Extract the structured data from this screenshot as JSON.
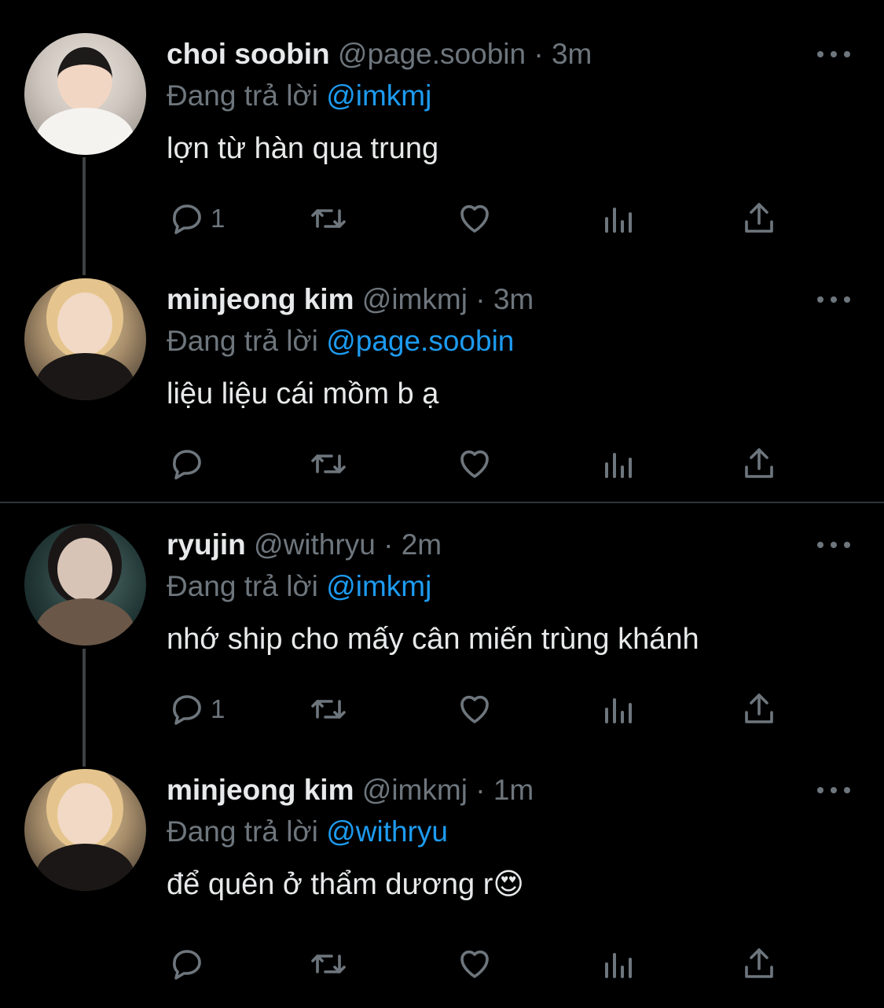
{
  "reply_prefix": "Đang trả lời",
  "dot": "·",
  "tweets": [
    {
      "name": "choi soobin",
      "handle": "@page.soobin",
      "time": "3m",
      "reply_to": "@imkmj",
      "text": "lợn từ hàn qua trung",
      "reply_count": "1"
    },
    {
      "name": "minjeong kim",
      "handle": "@imkmj",
      "time": "3m",
      "reply_to": "@page.soobin",
      "text": "liệu liệu cái mồm b ạ",
      "reply_count": ""
    },
    {
      "name": "ryujin",
      "handle": "@withryu",
      "time": "2m",
      "reply_to": "@imkmj",
      "text": "nhớ ship cho mấy cân miến trùng khánh",
      "reply_count": "1"
    },
    {
      "name": "minjeong kim",
      "handle": "@imkmj",
      "time": "1m",
      "reply_to": "@withryu",
      "text": "để quên ở thẩm dương r😍",
      "reply_count": ""
    }
  ],
  "icons": {
    "reply": "reply-icon",
    "retweet": "retweet-icon",
    "like": "heart-icon",
    "views": "analytics-icon",
    "share": "share-icon",
    "more": "more-dots-icon"
  },
  "colors": {
    "background": "#000000",
    "text": "#e7e9ea",
    "muted": "#6e767d",
    "mention": "#1d9bf0"
  }
}
